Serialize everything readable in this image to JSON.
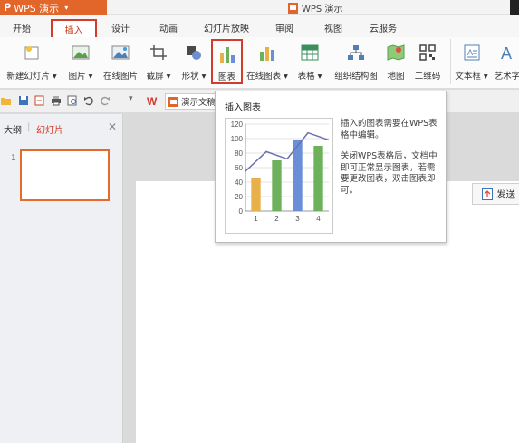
{
  "app": {
    "name": "WPS 演示",
    "window_title": "WPS 演示"
  },
  "menu": {
    "tabs": [
      "开始",
      "插入",
      "设计",
      "动画",
      "幻灯片放映",
      "审阅",
      "视图",
      "云服务"
    ],
    "active": "插入"
  },
  "ribbon": {
    "items": [
      {
        "label": "新建幻灯片 ▾",
        "icon": "new-slide-icon"
      },
      {
        "label": "图片 ▾",
        "icon": "picture-icon"
      },
      {
        "label": "在线图片",
        "icon": "online-picture-icon"
      },
      {
        "label": "截屏 ▾",
        "icon": "screenshot-icon"
      },
      {
        "label": "形状 ▾",
        "icon": "shape-icon"
      },
      {
        "label": "图表",
        "icon": "chart-icon"
      },
      {
        "label": "在线图表 ▾",
        "icon": "online-chart-icon"
      },
      {
        "label": "表格 ▾",
        "icon": "table-icon"
      },
      {
        "label": "组织结构图",
        "icon": "org-chart-icon"
      },
      {
        "label": "地图",
        "icon": "map-icon"
      },
      {
        "label": "二维码",
        "icon": "qrcode-icon"
      },
      {
        "label": "文本框 ▾",
        "icon": "textbox-icon"
      },
      {
        "label": "艺术字",
        "icon": "wordart-icon"
      }
    ]
  },
  "quickaccess": {
    "doc_tab": "演示文稿"
  },
  "left_panel": {
    "tab_outline": "大纲",
    "tab_slides": "幻灯片",
    "slide_number": "1"
  },
  "send_button": {
    "label": "发送"
  },
  "tooltip": {
    "title": "插入图表",
    "desc1": "插入的图表需要在WPS表格中编辑。",
    "desc2": "关闭WPS表格后，文档中即可正常显示图表，若需要更改图表，双击图表即可。"
  },
  "chart_data": {
    "type": "bar",
    "categories": [
      "1",
      "2",
      "3",
      "4"
    ],
    "values": [
      45,
      70,
      98,
      90
    ],
    "line_values": [
      55,
      82,
      72,
      108,
      98
    ],
    "colors": [
      "#e8b04a",
      "#6db25a",
      "#6a8fd8",
      "#6db25a"
    ],
    "line_color": "#6c6fb0",
    "ylim": [
      0,
      120
    ],
    "yticks": [
      "0",
      "20",
      "40",
      "60",
      "80",
      "100",
      "120"
    ]
  },
  "colors": {
    "accent": "#d23c2b",
    "app_orange": "#e2652a"
  }
}
